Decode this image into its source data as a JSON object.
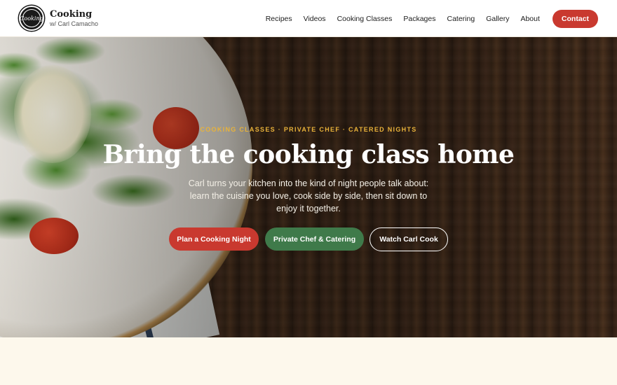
{
  "brand": {
    "badge_text": "Cooking",
    "title": "Cooking",
    "subtitle": "w/ Carl Camacho"
  },
  "nav": {
    "items": [
      {
        "label": "Recipes"
      },
      {
        "label": "Videos"
      },
      {
        "label": "Cooking Classes"
      },
      {
        "label": "Packages"
      },
      {
        "label": "Catering"
      },
      {
        "label": "Gallery"
      },
      {
        "label": "About"
      }
    ],
    "contact_label": "Contact"
  },
  "hero": {
    "eyebrow": "COOKING CLASSES · PRIVATE CHEF · CATERED NIGHTS",
    "headline": "Bring the cooking class home",
    "subtext": "Carl turns your kitchen into the kind of night people talk about: learn the cuisine you love, cook side by side, then sit down to enjoy it together.",
    "buttons": {
      "primary": "Plan a Cooking Night",
      "secondary": "Private Chef & Catering",
      "tertiary": "Watch Carl Cook"
    }
  },
  "colors": {
    "accent_red": "#c9392f",
    "accent_green": "#3f7a4a",
    "eyebrow_gold": "#e8b23a",
    "page_background": "#fdf8ec"
  }
}
